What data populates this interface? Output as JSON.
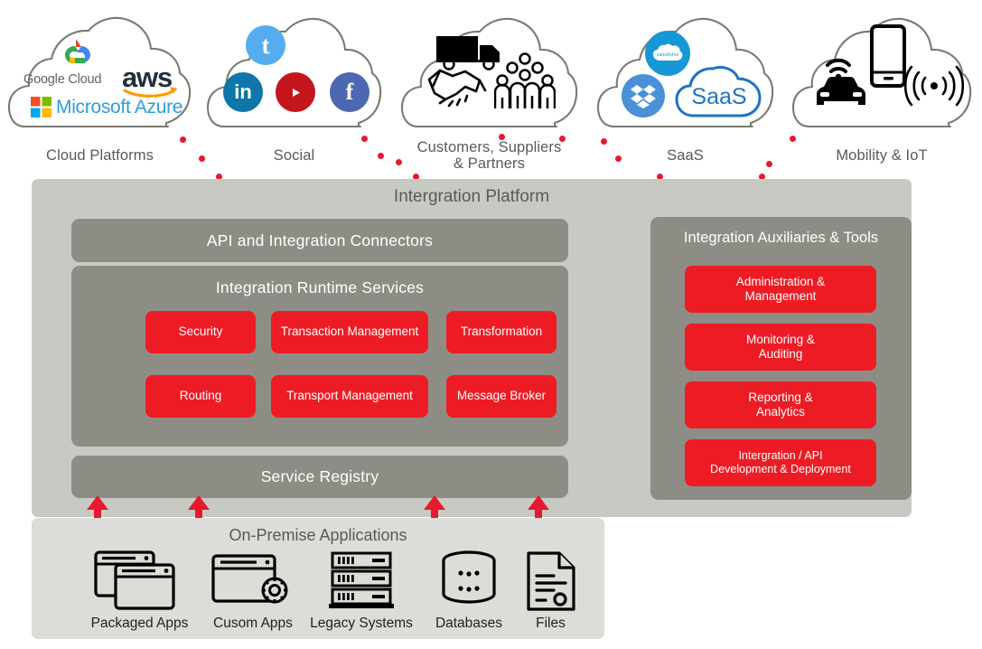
{
  "clouds": [
    {
      "id": "cloud-platforms",
      "label": "Cloud Platforms",
      "logos": [
        "google-cloud-logo",
        "aws-logo",
        "microsoft-azure-logo"
      ],
      "logo_text": {
        "google": "Google Cloud",
        "aws": "aws",
        "azure": "Microsoft Azure"
      }
    },
    {
      "id": "social",
      "label": "Social",
      "logos": [
        "twitter-icon",
        "linkedin-icon",
        "youtube-icon",
        "facebook-icon"
      ],
      "logo_text": {
        "twitter": "t",
        "linkedin": "in",
        "facebook": "f"
      }
    },
    {
      "id": "customers-suppliers-partners",
      "label": "Customers, Suppliers\n& Partners",
      "logos": [
        "truck-icon",
        "handshake-icon",
        "people-group-icon"
      ],
      "logo_text": {}
    },
    {
      "id": "saas",
      "label": "SaaS",
      "logos": [
        "salesforce-icon",
        "dropbox-icon",
        "saas-cloud-icon"
      ],
      "logo_text": {
        "salesforce": "salesforce",
        "saas": "SaaS"
      }
    },
    {
      "id": "mobility-iot",
      "label": "Mobility & IoT",
      "logos": [
        "connected-car-icon",
        "smartphone-icon",
        "signal-waves-icon"
      ],
      "logo_text": {}
    }
  ],
  "platform": {
    "title": "Intergration Platform",
    "connectors_band": "API and Integration Connectors",
    "runtime": {
      "title": "Integration Runtime Services",
      "services": [
        "Security",
        "Transaction Management",
        "Transformation",
        "Routing",
        "Transport Management",
        "Message Broker"
      ]
    },
    "service_registry": "Service Registry",
    "auxiliaries": {
      "title": "Integration Auxiliaries & Tools",
      "items": [
        "Administration &\nManagement",
        "Monitoring &\nAuditing",
        "Reporting &\nAnalytics",
        "Intergration / API\nDevelopment & Deployment"
      ]
    }
  },
  "onpremise": {
    "title": "On-Premise Applications",
    "items": [
      {
        "label": "Packaged Apps",
        "icon": "stacked-windows-icon"
      },
      {
        "label": "Cusom Apps",
        "icon": "window-gear-icon"
      },
      {
        "label": "Legacy Systems",
        "icon": "server-rack-icon"
      },
      {
        "label": "Databases",
        "icon": "database-cylinder-icon"
      },
      {
        "label": "Files",
        "icon": "document-icon"
      }
    ]
  },
  "colors": {
    "accent_red": "#ed1c24",
    "dot_red": "#e8192c",
    "platform_bg": "#c9c9c4",
    "band_gray": "#8d8d86",
    "onprem_bg": "#dcdcd8",
    "text_gray": "#58595b",
    "cloud_outline": "#7a7a74"
  }
}
